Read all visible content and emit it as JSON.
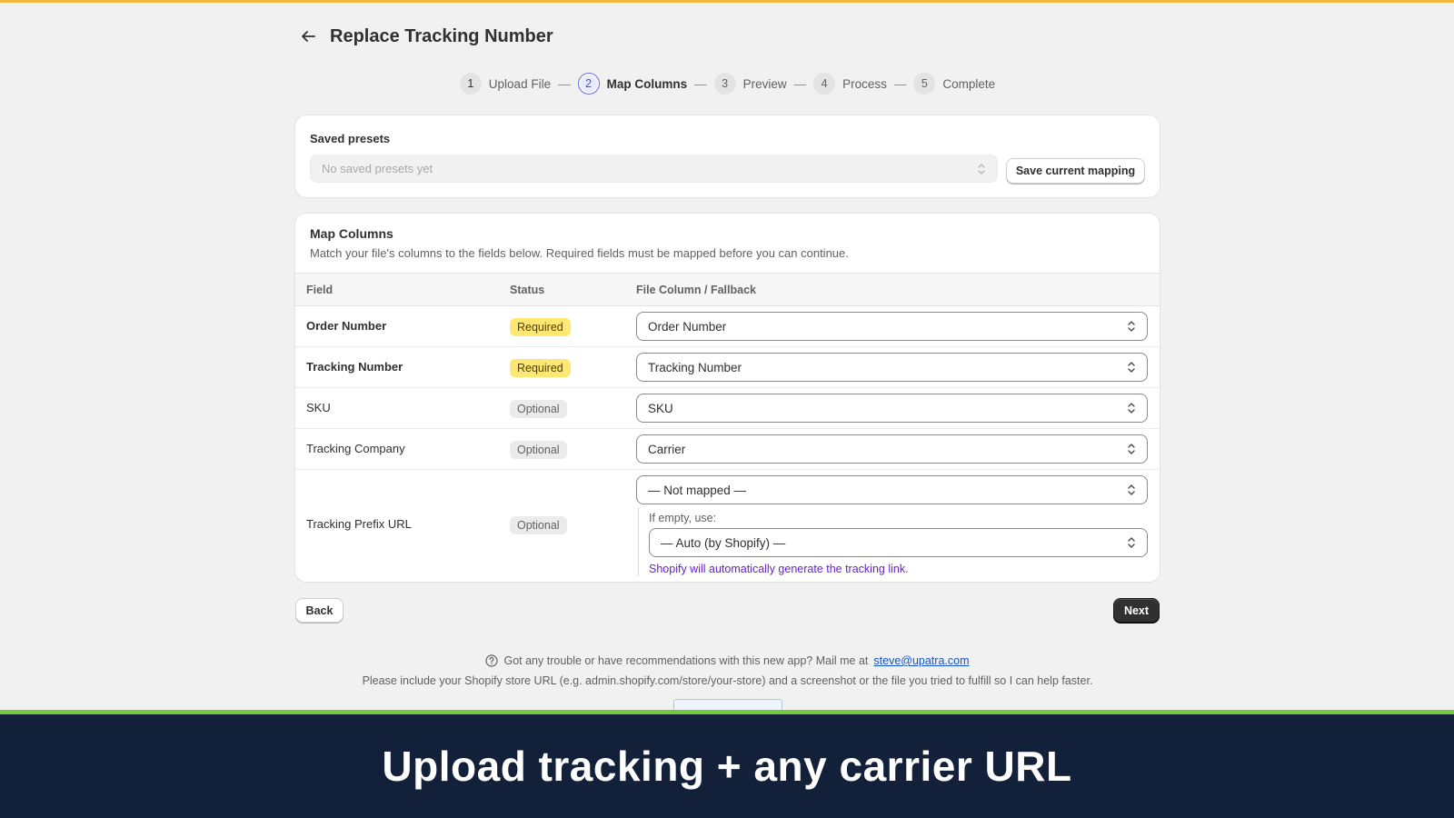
{
  "header": {
    "title": "Replace Tracking Number"
  },
  "stepper": {
    "steps": [
      {
        "num": "1",
        "label": "Upload File"
      },
      {
        "num": "2",
        "label": "Map Columns"
      },
      {
        "num": "3",
        "label": "Preview"
      },
      {
        "num": "4",
        "label": "Process"
      },
      {
        "num": "5",
        "label": "Complete"
      }
    ],
    "separator": "—"
  },
  "presets": {
    "title": "Saved presets",
    "placeholder": "No saved presets yet",
    "save_label": "Save current mapping"
  },
  "map": {
    "title": "Map Columns",
    "subtitle": "Match your file's columns to the fields below. Required fields must be mapped before you can continue.",
    "headers": {
      "field": "Field",
      "status": "Status",
      "column": "File Column / Fallback"
    },
    "rows": [
      {
        "field": "Order Number",
        "status": "Required",
        "value": "Order Number"
      },
      {
        "field": "Tracking Number",
        "status": "Required",
        "value": "Tracking Number"
      },
      {
        "field": "SKU",
        "status": "Optional",
        "value": "SKU"
      },
      {
        "field": "Tracking Company",
        "status": "Optional",
        "value": "Carrier"
      },
      {
        "field": "Tracking Prefix URL",
        "status": "Optional",
        "value": "— Not mapped —"
      }
    ],
    "fallback": {
      "label": "If empty, use:",
      "value": "— Auto (by Shopify) —",
      "hint": "Shopify will automatically generate the tracking link."
    }
  },
  "nav": {
    "back": "Back",
    "next": "Next"
  },
  "help": {
    "line1": "Got any trouble or have recommendations with this new app? Mail me at",
    "email": "steve@upatra.com",
    "line2": "Please include your Shopify store URL (e.g. admin.shopify.com/store/your-store) and a screenshot or the file you tried to fulfill so I can help faster."
  },
  "banner": {
    "text": "Upload tracking + any carrier URL"
  },
  "colors": {
    "accent_top": "#f6b73c",
    "banner_bg": "#12203a",
    "banner_stripe": "#74c93c",
    "required": "#ffe774",
    "hint": "#6b21c8"
  },
  "icons": {
    "back": "arrow-left-icon",
    "select": "chevron-up-down-icon",
    "help": "question-circle-icon"
  }
}
